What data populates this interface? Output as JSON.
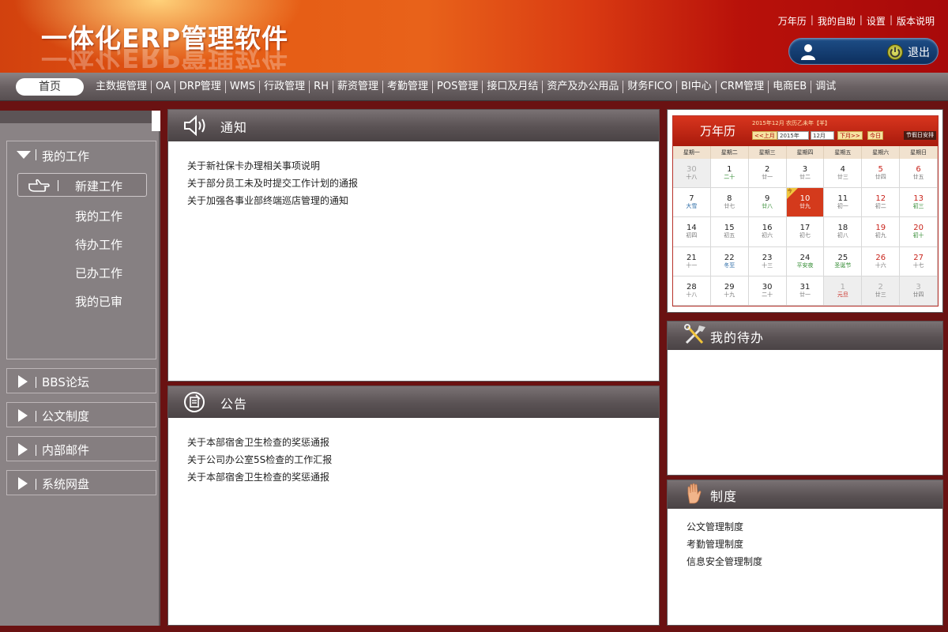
{
  "header": {
    "title": "一体化ERP管理软件",
    "links": [
      "万年历",
      "我的自助",
      "设置",
      "版本说明"
    ],
    "logout_label": "退出"
  },
  "nav": {
    "home": "首页",
    "items": [
      "主数据管理",
      "OA",
      "DRP管理",
      "WMS",
      "行政管理",
      "RH",
      "薪资管理",
      "考勤管理",
      "POS管理",
      "接口及月结",
      "资产及办公用品",
      "财务FICO",
      "BI中心",
      "CRM管理",
      "电商EB",
      "调试"
    ]
  },
  "sidebar": {
    "my_work": {
      "title": "我的工作",
      "new_work": "新建工作",
      "items": [
        "我的工作",
        "待办工作",
        "已办工作",
        "我的已审"
      ]
    },
    "sections": [
      "BBS论坛",
      "公文制度",
      "内部邮件",
      "系统网盘"
    ]
  },
  "notice": {
    "title": "通知",
    "items": [
      "关于新社保卡办理相关事项说明",
      "关于部分员工未及时提交工作计划的通报",
      "关于加强各事业部终端巡店管理的通知"
    ]
  },
  "announcement": {
    "title": "公告",
    "items": [
      "关于本部宿舍卫生检查的奖惩通报",
      "关于公司办公室5S检查的工作汇报",
      "关于本部宿舍卫生检查的奖惩通报"
    ]
  },
  "calendar": {
    "title": "万年历",
    "subtitle": "2015年12月 农历乙未年【羊】",
    "prev": "<<上月",
    "year": "2015年",
    "month": "12月",
    "next": "下月>>",
    "today_btn": "今日",
    "holiday": "节假日安排",
    "today_flag": "今",
    "weekdays": [
      "星期一",
      "星期二",
      "星期三",
      "星期四",
      "星期五",
      "星期六",
      "星期日"
    ],
    "days": [
      {
        "d": "30",
        "l": "十八",
        "other": true
      },
      {
        "d": "1",
        "l": "二十",
        "lc": "green"
      },
      {
        "d": "2",
        "l": "廿一"
      },
      {
        "d": "3",
        "l": "廿二"
      },
      {
        "d": "4",
        "l": "廿三"
      },
      {
        "d": "5",
        "l": "廿四",
        "we": true
      },
      {
        "d": "6",
        "l": "廿五",
        "we": true
      },
      {
        "d": "7",
        "l": "大雪",
        "lc": "blue"
      },
      {
        "d": "8",
        "l": "廿七"
      },
      {
        "d": "9",
        "l": "廿八",
        "lc": "green"
      },
      {
        "d": "10",
        "l": "廿九",
        "today": true
      },
      {
        "d": "11",
        "l": "初一"
      },
      {
        "d": "12",
        "l": "初二",
        "we": true
      },
      {
        "d": "13",
        "l": "初三",
        "we": true,
        "lc": "green"
      },
      {
        "d": "14",
        "l": "初四"
      },
      {
        "d": "15",
        "l": "初五"
      },
      {
        "d": "16",
        "l": "初六"
      },
      {
        "d": "17",
        "l": "初七"
      },
      {
        "d": "18",
        "l": "初八"
      },
      {
        "d": "19",
        "l": "初九",
        "we": true
      },
      {
        "d": "20",
        "l": "初十",
        "we": true,
        "lc": "green"
      },
      {
        "d": "21",
        "l": "十一"
      },
      {
        "d": "22",
        "l": "冬至",
        "lc": "blue"
      },
      {
        "d": "23",
        "l": "十三"
      },
      {
        "d": "24",
        "l": "平安夜",
        "lc": "green"
      },
      {
        "d": "25",
        "l": "圣诞节",
        "lc": "green"
      },
      {
        "d": "26",
        "l": "十六",
        "we": true
      },
      {
        "d": "27",
        "l": "十七",
        "we": true
      },
      {
        "d": "28",
        "l": "十八"
      },
      {
        "d": "29",
        "l": "十九"
      },
      {
        "d": "30",
        "l": "二十"
      },
      {
        "d": "31",
        "l": "廿一"
      },
      {
        "d": "1",
        "l": "元旦",
        "other": true,
        "lc": "red"
      },
      {
        "d": "2",
        "l": "廿三",
        "other": true
      },
      {
        "d": "3",
        "l": "廿四",
        "other": true
      }
    ]
  },
  "todo": {
    "title": "我的待办"
  },
  "rules": {
    "title": "制度",
    "items": [
      "公文管理制度",
      "考勤管理制度",
      "信息安全管理制度"
    ]
  }
}
